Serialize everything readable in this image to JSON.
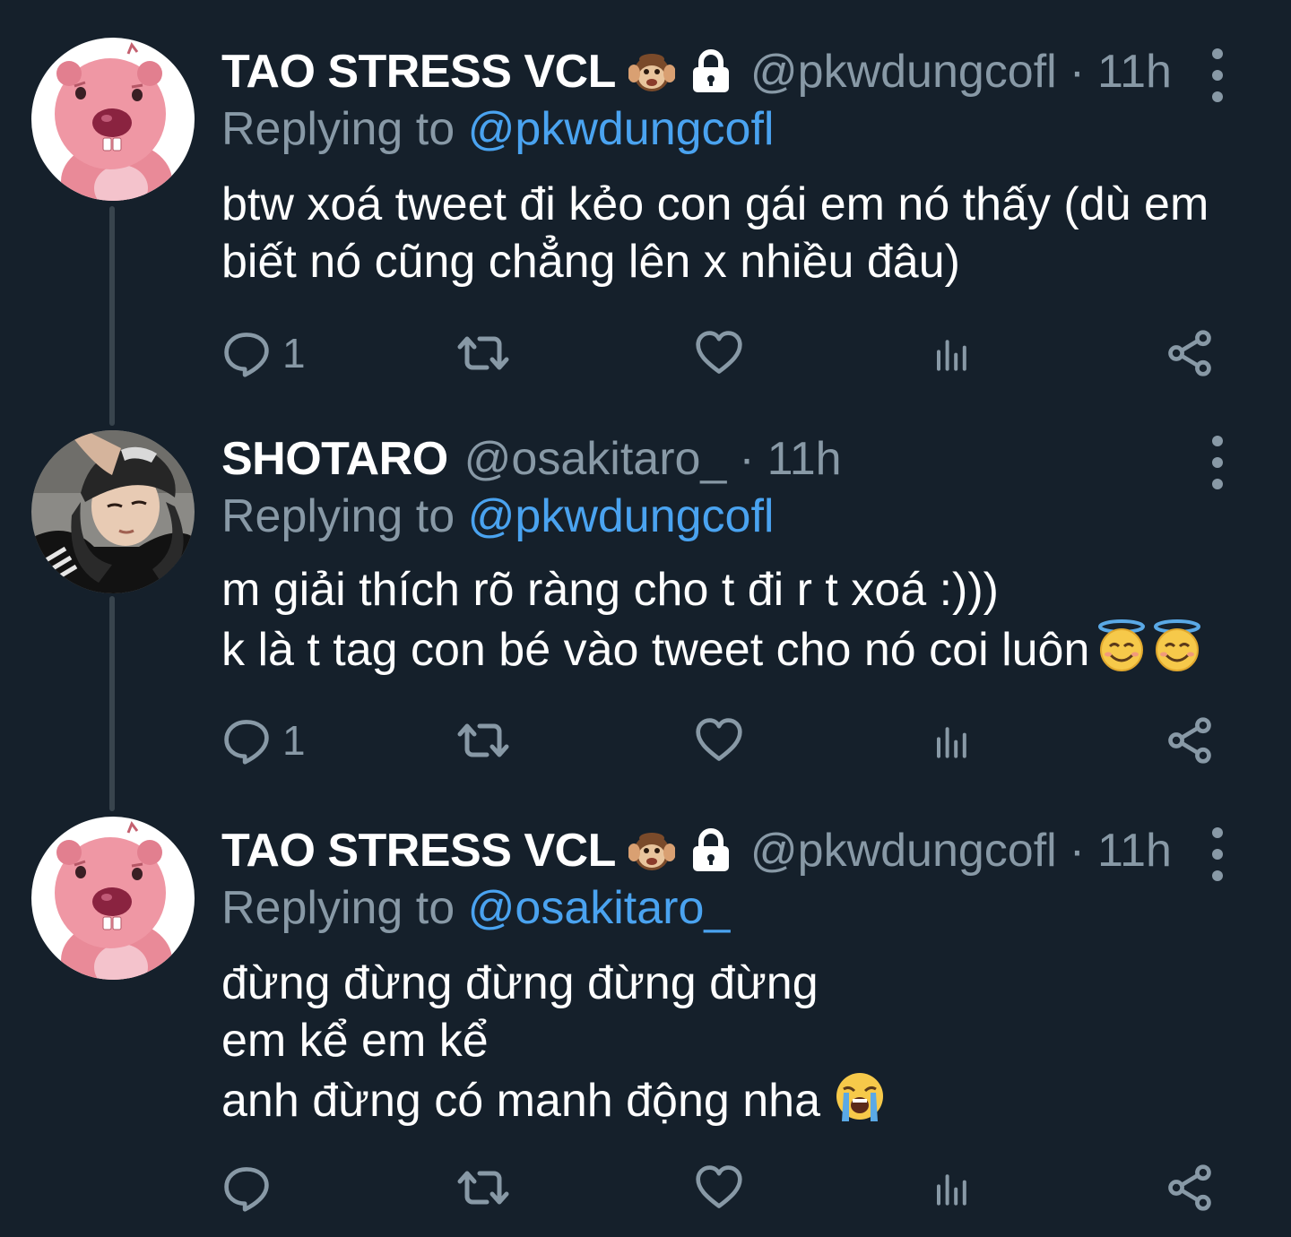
{
  "colors": {
    "background": "#15202b",
    "text_primary": "#ffffff",
    "text_secondary": "#8899a6",
    "link": "#4aa3f0",
    "thread_line": "#38444d"
  },
  "tweets": [
    {
      "display_name": "TAO STRESS VCL",
      "badges": [
        "hear-no-evil-monkey-emoji",
        "lock-icon"
      ],
      "handle": "@pkwdungcofl",
      "separator": "·",
      "time": "11h",
      "replying_prefix": "Replying to",
      "replying_to": "@pkwdungcofl",
      "body_lines": [
        "btw xoá tweet đi kẻo con gái em nó thấy (dù em",
        "biết nó cũng chẳng lên x nhiều đâu)"
      ],
      "reply_count": "1",
      "avatar": "pink-beaver-avatar"
    },
    {
      "display_name": "SHOTARO",
      "badges": [],
      "handle": "@osakitaro_",
      "separator": "·",
      "time": "11h",
      "replying_prefix": "Replying to",
      "replying_to": "@pkwdungcofl",
      "body_lines": [
        "m giải thích rõ ràng cho t đi r t xoá :)))",
        "k là t tag con bé vào tweet cho nó coi luôn"
      ],
      "body_emojis": [
        "smiling-face-with-halo-emoji",
        "smiling-face-with-halo-emoji"
      ],
      "reply_count": "1",
      "avatar": "person-bandana-photo-avatar"
    },
    {
      "display_name": "TAO STRESS VCL",
      "badges": [
        "hear-no-evil-monkey-emoji",
        "lock-icon"
      ],
      "handle": "@pkwdungcofl",
      "separator": "·",
      "time": "11h",
      "replying_prefix": "Replying to",
      "replying_to": "@osakitaro_",
      "body_lines": [
        "đừng đừng đừng đừng đừng",
        "em kể em kể",
        "anh đừng có manh động nha"
      ],
      "body_emojis": [
        "loudly-crying-face-emoji"
      ],
      "reply_count": "",
      "avatar": "pink-beaver-avatar"
    }
  ],
  "action_icons": [
    "reply-icon",
    "retweet-icon",
    "like-icon",
    "analytics-icon",
    "share-icon"
  ]
}
